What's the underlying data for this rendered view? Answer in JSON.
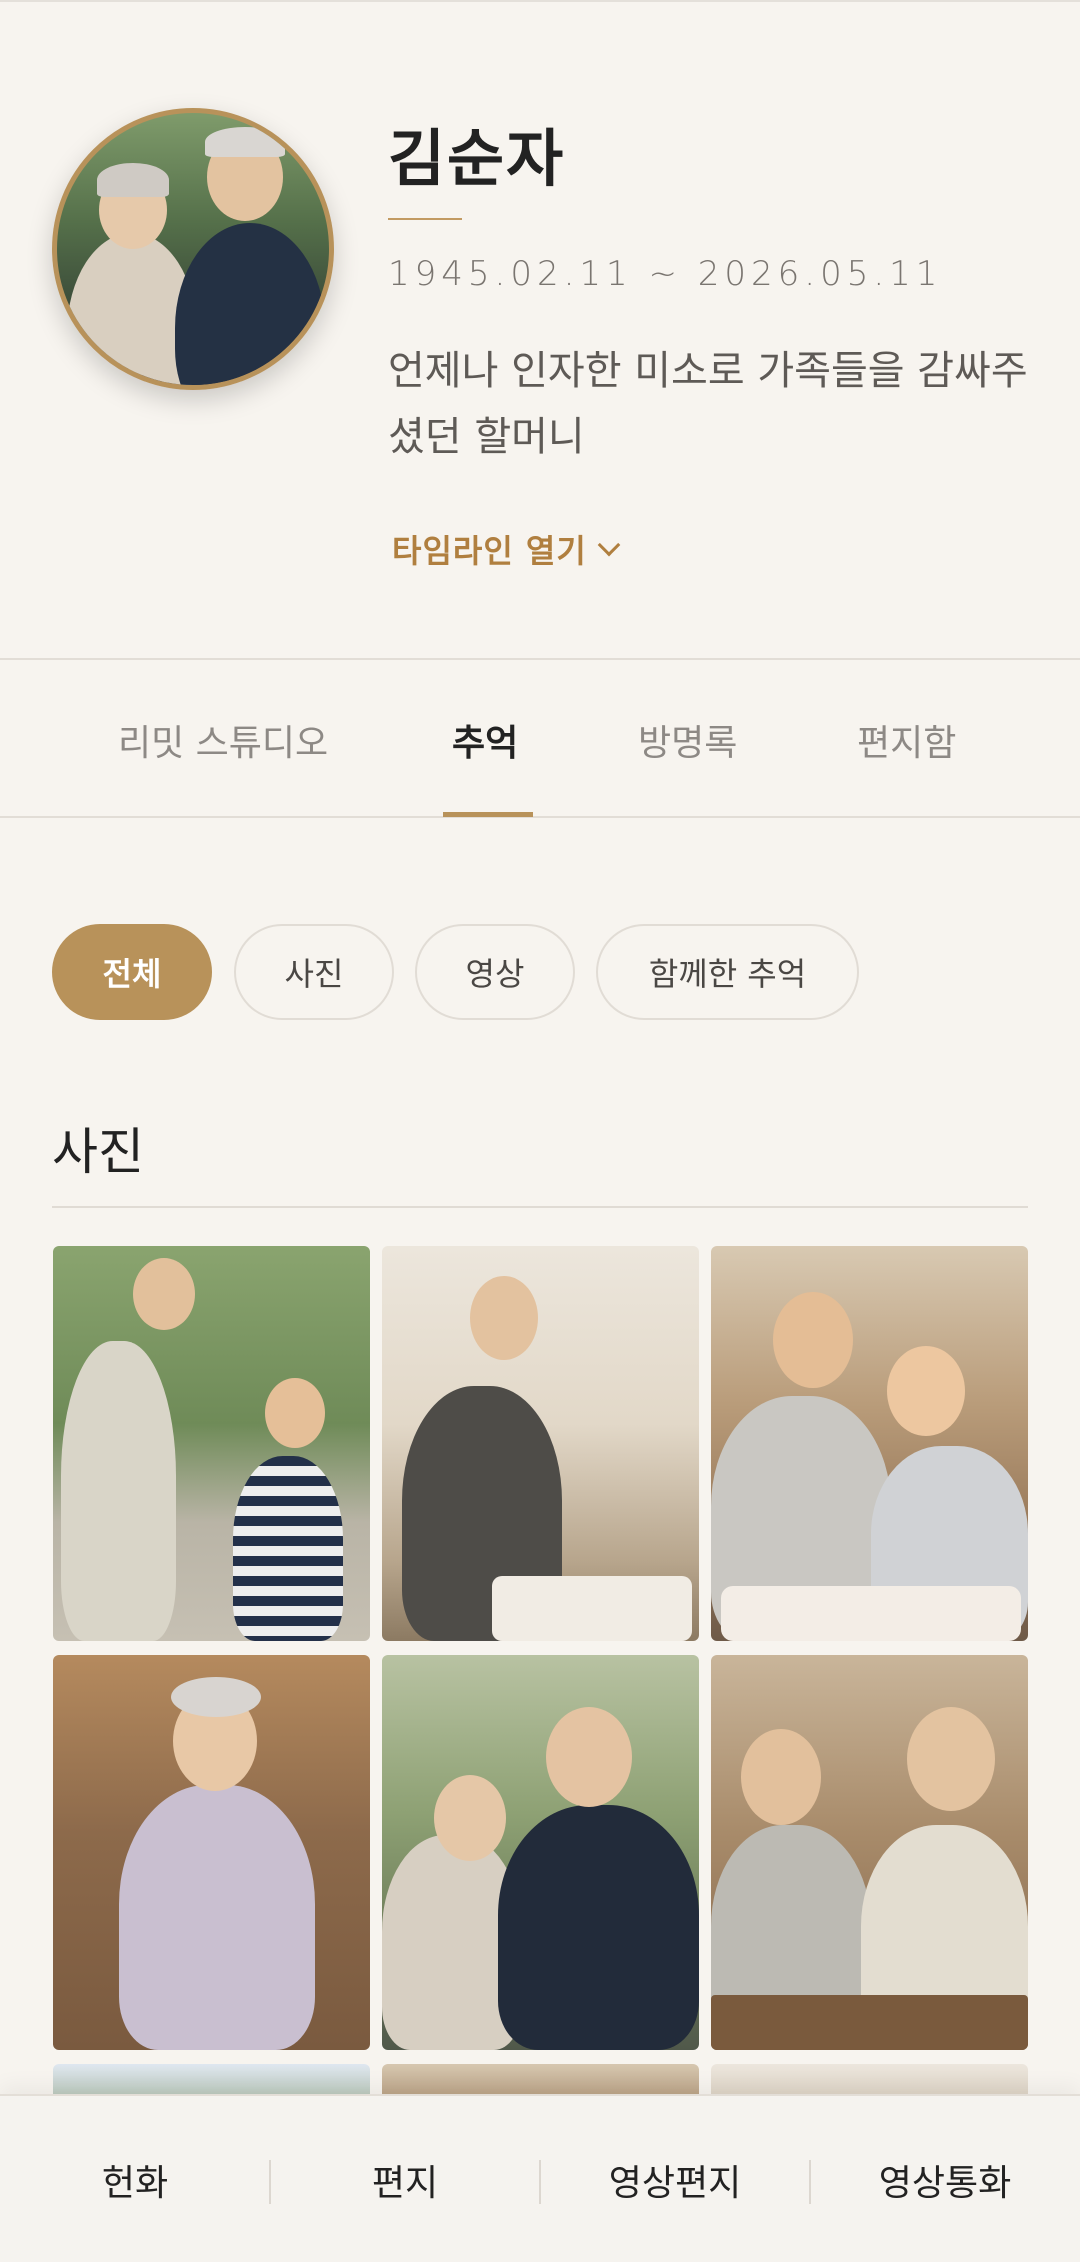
{
  "profile": {
    "name": "김순자",
    "dates": "1945.02.11 ~ 2026.05.11",
    "tagline": "언제나 인자한 미소로 가족들을 감싸주셨던 할머니",
    "timeline_label": "타임라인 열기"
  },
  "tabs": [
    {
      "label": "리밋 스튜디오",
      "active": false
    },
    {
      "label": "추억",
      "active": true
    },
    {
      "label": "방명록",
      "active": false
    },
    {
      "label": "편지함",
      "active": false
    }
  ],
  "filters": [
    {
      "label": "전체",
      "active": true
    },
    {
      "label": "사진",
      "active": false
    },
    {
      "label": "영상",
      "active": false
    },
    {
      "label": "함께한 추억",
      "active": false
    }
  ],
  "section": {
    "title": "사진"
  },
  "bottom_bar": [
    {
      "label": "헌화"
    },
    {
      "label": "편지"
    },
    {
      "label": "영상편지"
    },
    {
      "label": "영상통화"
    }
  ],
  "colors": {
    "accent": "#b8925a",
    "background": "#f7f4ef"
  }
}
